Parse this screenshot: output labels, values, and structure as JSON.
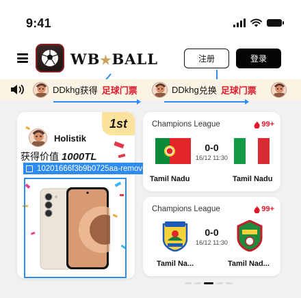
{
  "status": {
    "time": "9:41"
  },
  "header": {
    "brand": "WB",
    "brand_star": "★",
    "brand_tail": "BALL",
    "register_label": "注册",
    "login_label": "登录"
  },
  "ticker": {
    "items": [
      {
        "user": "DDkhg",
        "action": "获得",
        "prize": "足球门票"
      },
      {
        "user": "DDkhg",
        "action": "兑换",
        "prize": "足球门票"
      }
    ]
  },
  "prize_card": {
    "rank": "1st",
    "winner": "Holistik",
    "value_prefix": "获得价值",
    "value_amount": "1000TL",
    "selection_label": "10201666f3b9b0725aa-remove..."
  },
  "matches": [
    {
      "league": "Champions League",
      "hot": "99+",
      "score": "0-0",
      "time": "16/12 11:30",
      "home": "Tamil Nadu",
      "away": "Tamil Nadu"
    },
    {
      "league": "Champions League",
      "hot": "99+",
      "score": "0-0",
      "time": "16/12 11:30",
      "home": "Tamil Na...",
      "away": "Tamil Nad..."
    }
  ],
  "colors": {
    "accent_red": "#e0182a",
    "annotation_blue": "#2e8bf0",
    "ticker_bg": "#fbf3e4",
    "badge_gold": "#fbe39d"
  },
  "carousel": {
    "active_index": 2,
    "count": 5
  }
}
